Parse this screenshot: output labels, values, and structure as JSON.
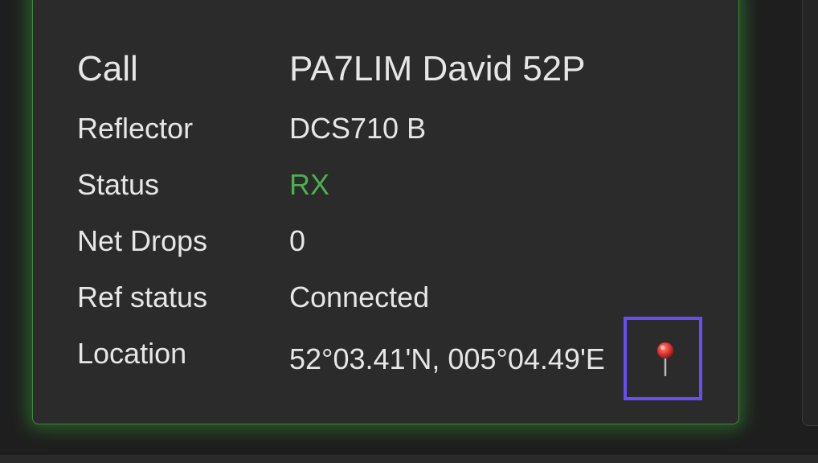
{
  "rows": [
    {
      "label": "Call",
      "value": "PA7LIM David 52P"
    },
    {
      "label": "Reflector",
      "value": "DCS710 B"
    },
    {
      "label": "Status",
      "value": "RX"
    },
    {
      "label": "Net Drops",
      "value": "0"
    },
    {
      "label": "Ref status",
      "value": "Connected"
    },
    {
      "label": "Location",
      "value": "52°03.41'N, 005°04.49'E"
    }
  ],
  "icons": {
    "location_pin": "map-pin-icon"
  },
  "colors": {
    "status_rx": "#4caf50",
    "card_glow": "#3d8a3d",
    "highlight_box": "#6a4ef5",
    "pin_head": "#e53935"
  }
}
